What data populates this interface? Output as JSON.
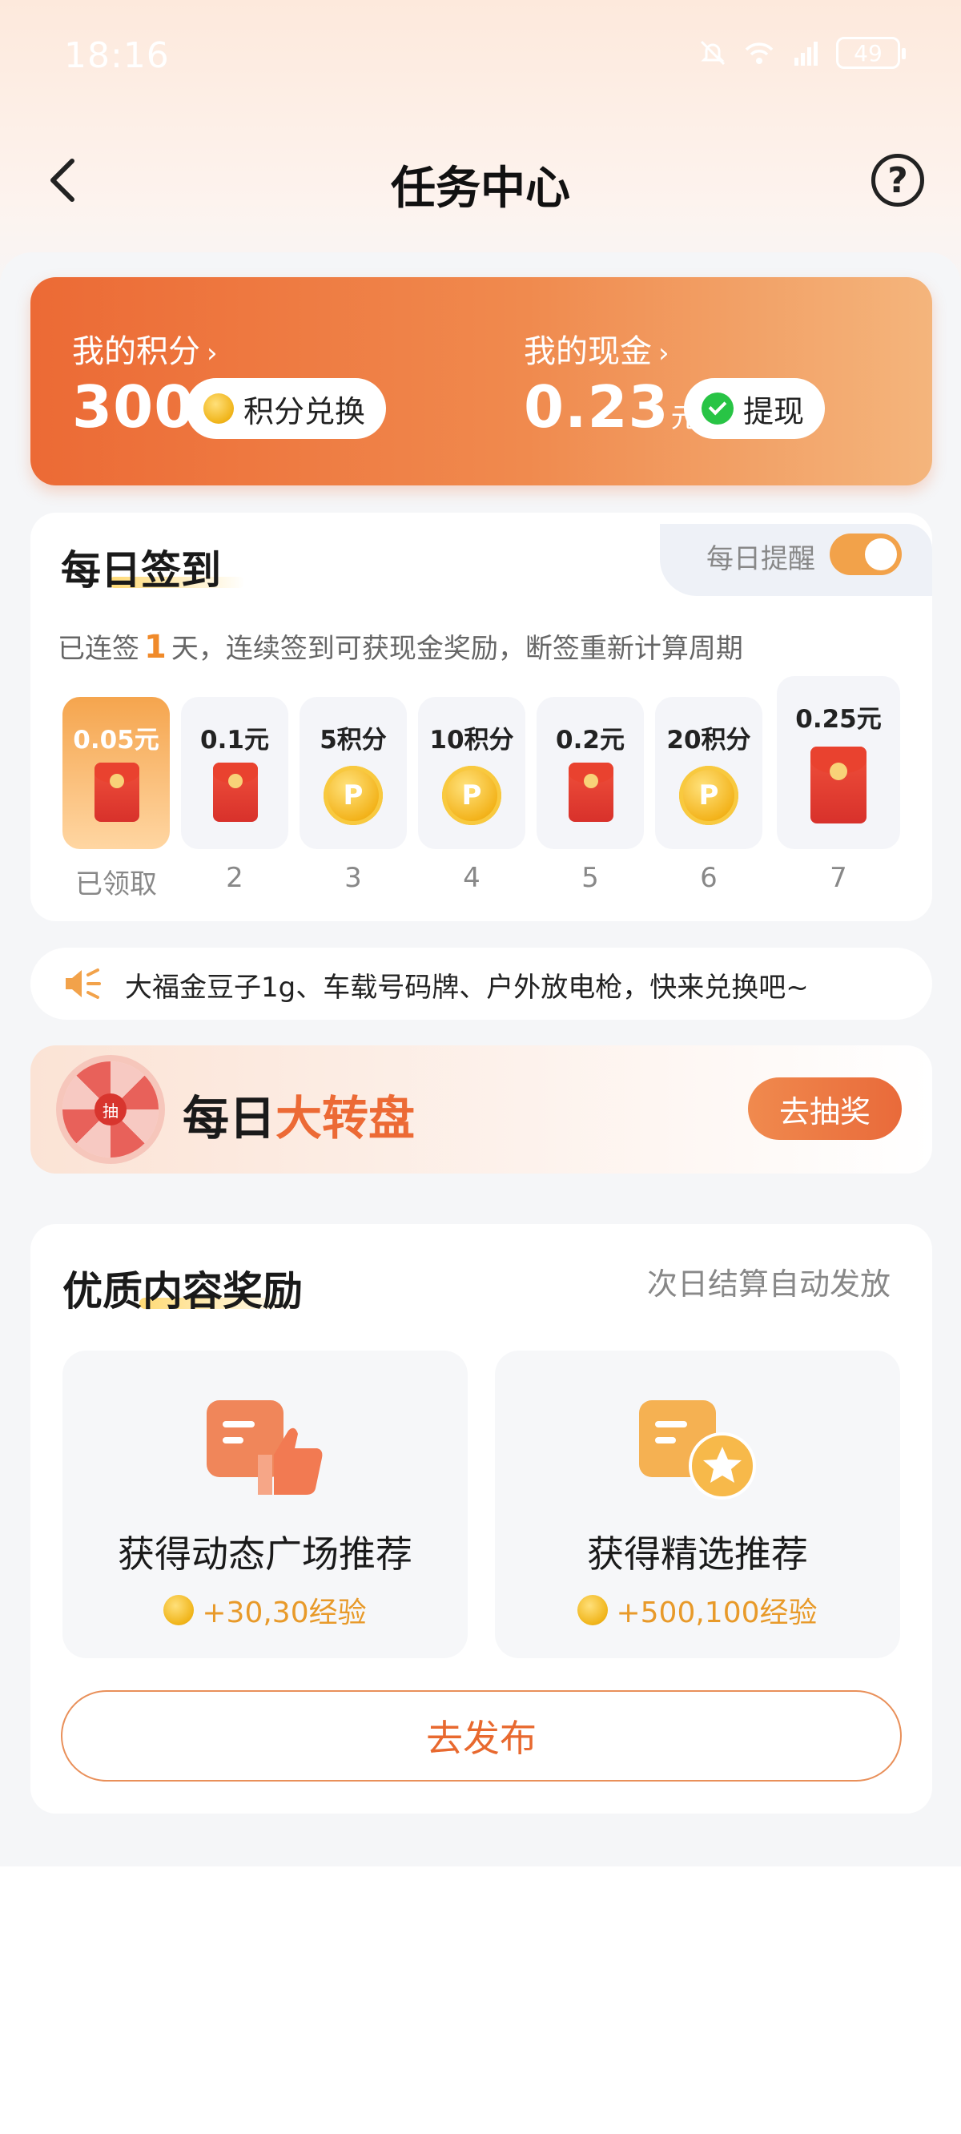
{
  "status_bar": {
    "time": "18:16",
    "battery": "49"
  },
  "header": {
    "title": "任务中心"
  },
  "points": {
    "points_label": "我的积分",
    "points_value": "300",
    "exchange_label": "积分兑换",
    "cash_label": "我的现金",
    "cash_value": "0.23",
    "cash_unit": "元",
    "withdraw_label": "提现"
  },
  "signin": {
    "title": "每日签到",
    "remind_label": "每日提醒",
    "remind_on": true,
    "desc_prefix": "已连签",
    "streak": "1",
    "desc_suffix": "天，连续签到可获现金奖励，断签重新计算周期",
    "days": [
      {
        "reward": "0.05元",
        "type": "cash",
        "label": "已领取"
      },
      {
        "reward": "0.1元",
        "type": "cash",
        "label": "2"
      },
      {
        "reward": "5积分",
        "type": "points",
        "label": "3"
      },
      {
        "reward": "10积分",
        "type": "points",
        "label": "4"
      },
      {
        "reward": "0.2元",
        "type": "cash",
        "label": "5"
      },
      {
        "reward": "20积分",
        "type": "points",
        "label": "6"
      },
      {
        "reward": "0.25元",
        "type": "cash",
        "label": "7"
      }
    ]
  },
  "notice": {
    "text": "大福金豆子1g、车载号码牌、户外放电枪，快来兑换吧~"
  },
  "wheel": {
    "title_main": "每日",
    "title_accent": "大转盘",
    "center_text": "抽",
    "button_label": "去抽奖"
  },
  "quality": {
    "title": "优质内容奖励",
    "subtitle": "次日结算自动发放",
    "items": [
      {
        "name": "获得动态广场推荐",
        "reward": "+30,30经验"
      },
      {
        "name": "获得精选推荐",
        "reward": "+500,100经验"
      }
    ],
    "publish_label": "去发布"
  },
  "colors": {
    "accent": "#ec6a35",
    "gold": "#e89a2a",
    "toggle": "#f2a24a"
  }
}
